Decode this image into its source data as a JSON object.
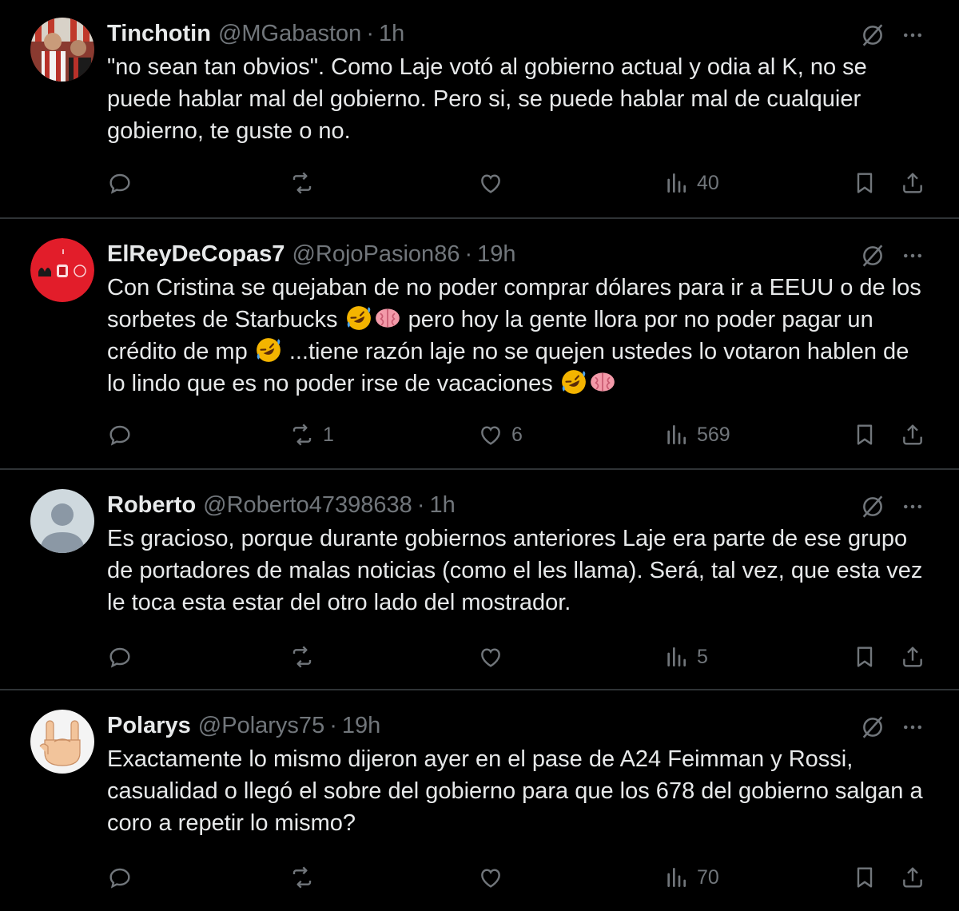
{
  "tweets": [
    {
      "name": "Tinchotin",
      "handle": "@MGabaston",
      "time": "1h",
      "text": "\"no sean tan obvios\". Como Laje votó al gobierno actual y odia al K, no se puede hablar mal del gobierno. Pero si, se puede hablar mal de cualquier gobierno, te guste o no.",
      "retweets": "",
      "likes": "",
      "views": "40"
    },
    {
      "name": "ElReyDeCopas7",
      "handle": "@RojoPasion86",
      "time": "19h",
      "text_parts": [
        "Con Cristina se quejaban de no poder comprar dólares para ir a EEUU o de los sorbetes de Starbucks ",
        " pero hoy la gente llora por no poder pagar un crédito de mp ",
        " ...tiene razón laje no se quejen ustedes lo votaron hablen de lo lindo que es no poder irse de vacaciones "
      ],
      "retweets": "1",
      "likes": "6",
      "views": "569"
    },
    {
      "name": "Roberto",
      "handle": "@Roberto47398638",
      "time": "1h",
      "text": "Es gracioso, porque durante gobiernos anteriores Laje era parte de ese grupo de portadores de malas noticias (como el les llama). Será, tal vez, que esta vez le toca esta estar del otro lado del mostrador.",
      "retweets": "",
      "likes": "",
      "views": "5"
    },
    {
      "name": "Polarys",
      "handle": "@Polarys75",
      "time": "19h",
      "text": "Exactamente lo mismo dijeron ayer en el pase de A24 Feimman y Rossi, casualidad o llegó el sobre del gobierno para que los 678 del gobierno salgan a coro a repetir lo mismo?",
      "retweets": "",
      "likes": "",
      "views": "70"
    }
  ],
  "separator": " · ",
  "icons": {
    "reply": "reply-icon",
    "retweet": "retweet-icon",
    "like": "heart-icon",
    "views": "views-icon",
    "bookmark": "bookmark-icon",
    "share": "share-icon",
    "grok": "grok-icon",
    "more": "more-icon",
    "emoji_laugh": "rolling-on-floor-laughing-emoji",
    "emoji_brain": "brain-emoji"
  },
  "colors": {
    "background": "#000000",
    "text": "#e7e9ea",
    "secondary": "#71767b",
    "divider": "#2f3336"
  }
}
